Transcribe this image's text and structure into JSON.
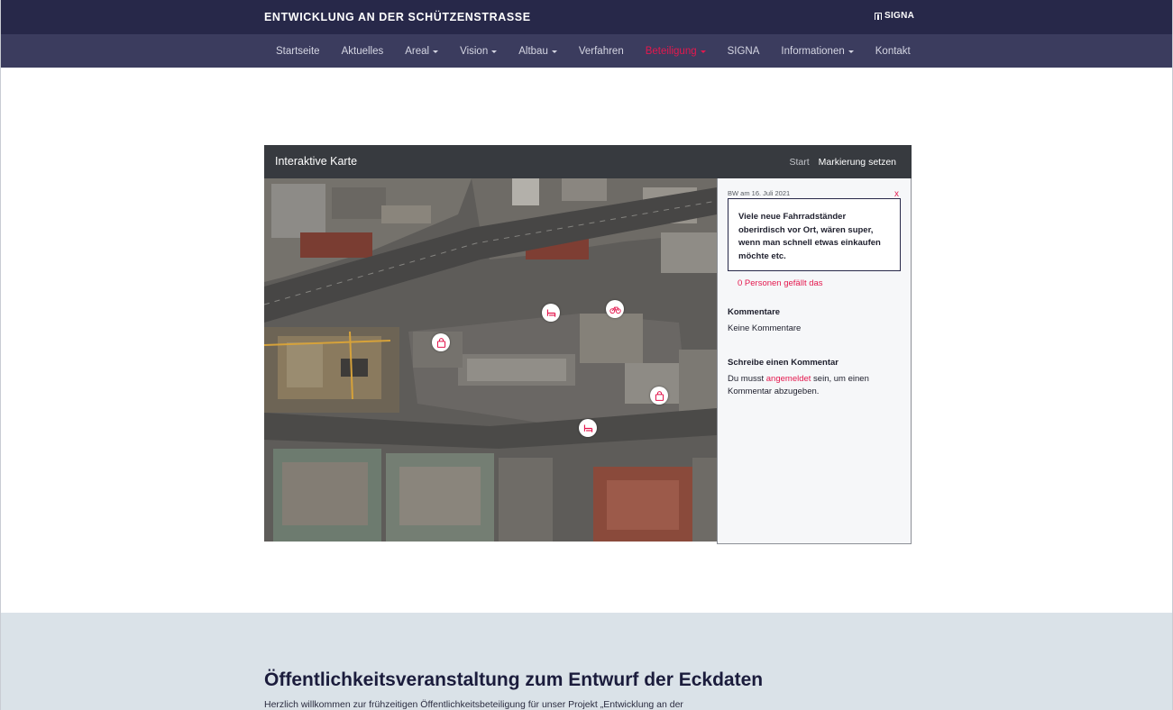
{
  "header": {
    "site_title": "ENTWICKLUNG AN DER SCHÜTZENSTRASSE",
    "brand": "SIGNA"
  },
  "nav": {
    "items": [
      {
        "label": "Startseite",
        "dropdown": false,
        "active": false
      },
      {
        "label": "Aktuelles",
        "dropdown": false,
        "active": false
      },
      {
        "label": "Areal",
        "dropdown": true,
        "active": false
      },
      {
        "label": "Vision",
        "dropdown": true,
        "active": false
      },
      {
        "label": "Altbau",
        "dropdown": true,
        "active": false
      },
      {
        "label": "Verfahren",
        "dropdown": false,
        "active": false
      },
      {
        "label": "Beteiligung",
        "dropdown": true,
        "active": true
      },
      {
        "label": "SIGNA",
        "dropdown": false,
        "active": false
      },
      {
        "label": "Informationen",
        "dropdown": true,
        "active": false
      },
      {
        "label": "Kontakt",
        "dropdown": false,
        "active": false
      }
    ]
  },
  "map": {
    "title": "Interaktive Karte",
    "start_label": "Start",
    "mark_label": "Markierung setzen",
    "pins": [
      {
        "icon": "bench-icon"
      },
      {
        "icon": "bicycle-icon"
      },
      {
        "icon": "shopping-bag-icon"
      },
      {
        "icon": "shopping-bag-icon"
      },
      {
        "icon": "bench-icon"
      }
    ]
  },
  "panel": {
    "meta": "BW am 16. Juli 2021",
    "close": "x",
    "comment": "Viele neue Fahrradständer oberirdisch vor Ort, wären super, wenn man schnell etwas einkaufen möchte etc.",
    "likes": "0 Personen gefällt das",
    "comments_heading": "Kommentare",
    "no_comments": "Keine Kommentare",
    "write_heading": "Schreibe einen Kommentar",
    "login_prefix": "Du musst ",
    "login_link": "angemeldet",
    "login_suffix": " sein, um einen Kommentar abzugeben."
  },
  "lower": {
    "title": "Öffentlichkeitsveranstaltung zum Entwurf der Eckdaten",
    "intro": "Herzlich willkommen zur frühzeitigen Öffentlichkeitsbeteiligung für unser Projekt „Entwicklung an der"
  },
  "colors": {
    "header_bg": "#272849",
    "nav_bg": "#3b3c5e",
    "accent": "#e4184e",
    "map_header_bg": "#373a3f",
    "lower_bg": "#dae2e8"
  }
}
